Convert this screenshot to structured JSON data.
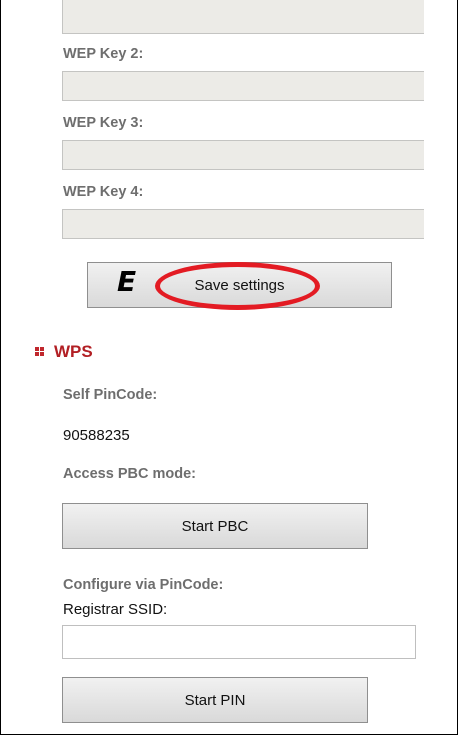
{
  "wep": {
    "key2_label": "WEP Key 2:",
    "key3_label": "WEP Key 3:",
    "key4_label": "WEP Key 4:",
    "key1_value": "",
    "key2_value": "",
    "key3_value": "",
    "key4_value": ""
  },
  "save_button_label": "Save settings",
  "annotation_marker": "E",
  "wps": {
    "title": "WPS",
    "self_pincode_label": "Self PinCode:",
    "self_pincode_value": "90588235",
    "pbc_label": "Access PBC mode:",
    "start_pbc_label": "Start PBC",
    "configure_label": "Configure via PinCode:",
    "registrar_label": "Registrar SSID:",
    "registrar_value": "",
    "start_pin_label": "Start PIN"
  },
  "colors": {
    "section_title": "#b21f24",
    "annotation_ring": "#e31b23",
    "field_background": "#ecebe7"
  }
}
